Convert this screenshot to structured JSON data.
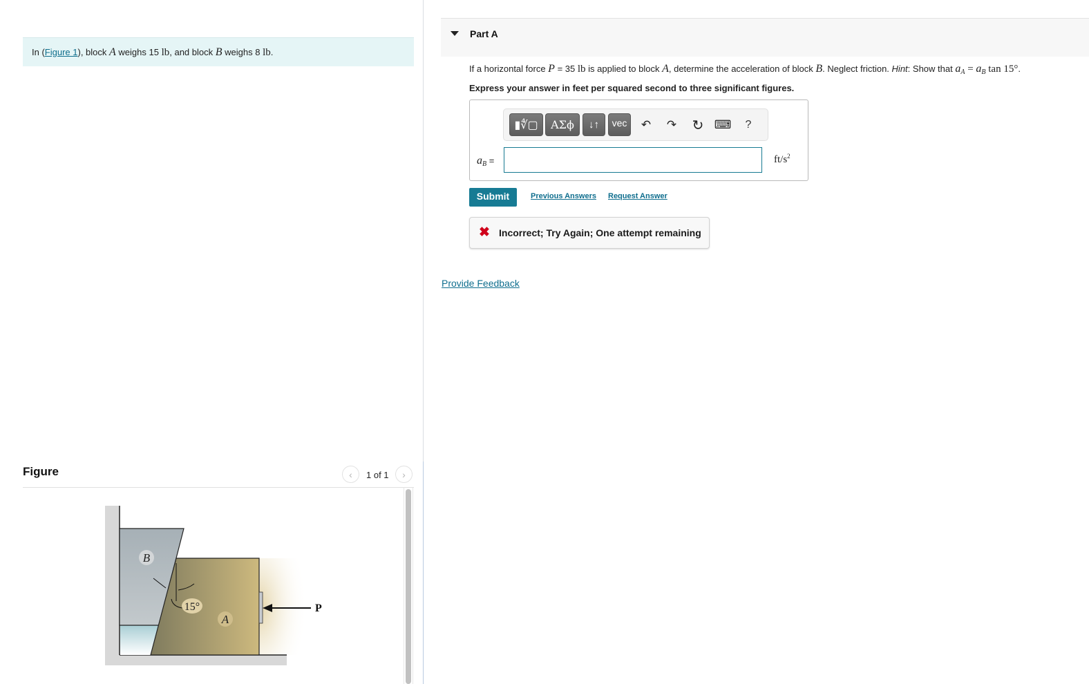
{
  "intro": {
    "prefix": "In (",
    "figure_link": "Figure 1",
    "after_link": "), block ",
    "block_a": "A",
    "weighs_a": " weighs 15 ",
    "unit_lb": "lb",
    "mid": ", and block ",
    "block_b": "B",
    "weighs_b": " weighs 8 ",
    "end": "."
  },
  "figure_panel": {
    "title": "Figure",
    "pager_text": "1 of 1",
    "prev_icon": "‹",
    "next_icon": "›",
    "labels": {
      "block_b": "B",
      "block_a": "A",
      "angle": "15°",
      "force": "P"
    }
  },
  "part": {
    "title": "Part A",
    "question": {
      "t1": "If a horizontal force ",
      "p": "P",
      "t2": " = 35 ",
      "lb": "lb",
      "t3": " is applied to block ",
      "a": "A",
      "t4": ", determine the acceleration of block ",
      "b": "B",
      "t5": ". Neglect friction. ",
      "hint_label": "Hint",
      "t6": ": Show that ",
      "aa": "a",
      "aa_sub": "A",
      "eq": " = ",
      "ab": "a",
      "ab_sub": "B",
      "tan": " tan 15°",
      "t7": "."
    },
    "instruction": "Express your answer in feet per squared second to three significant figures."
  },
  "toolbar": {
    "templates_label": "▮∜▢",
    "greek_label": "ΑΣϕ",
    "arrows_label": "↓↑",
    "vec_label": "vec",
    "undo_icon": "↶",
    "redo_icon": "↷",
    "reset_icon": "↻",
    "keyboard_icon": "⌨",
    "help_label": "?"
  },
  "answer": {
    "variable": "a",
    "variable_sub": "B",
    "equals": " =",
    "value": "",
    "unit": "ft/s",
    "unit_exp": "2"
  },
  "actions": {
    "submit": "Submit",
    "previous_answers": "Previous Answers",
    "request_answer": "Request Answer"
  },
  "feedback": {
    "icon": "✖",
    "message": "Incorrect; Try Again; One attempt remaining"
  },
  "provide_feedback": "Provide Feedback",
  "colors": {
    "accent": "#177b94",
    "link": "#0f6e8e",
    "error": "#d0021b",
    "intro_bg": "#e5f5f6"
  }
}
